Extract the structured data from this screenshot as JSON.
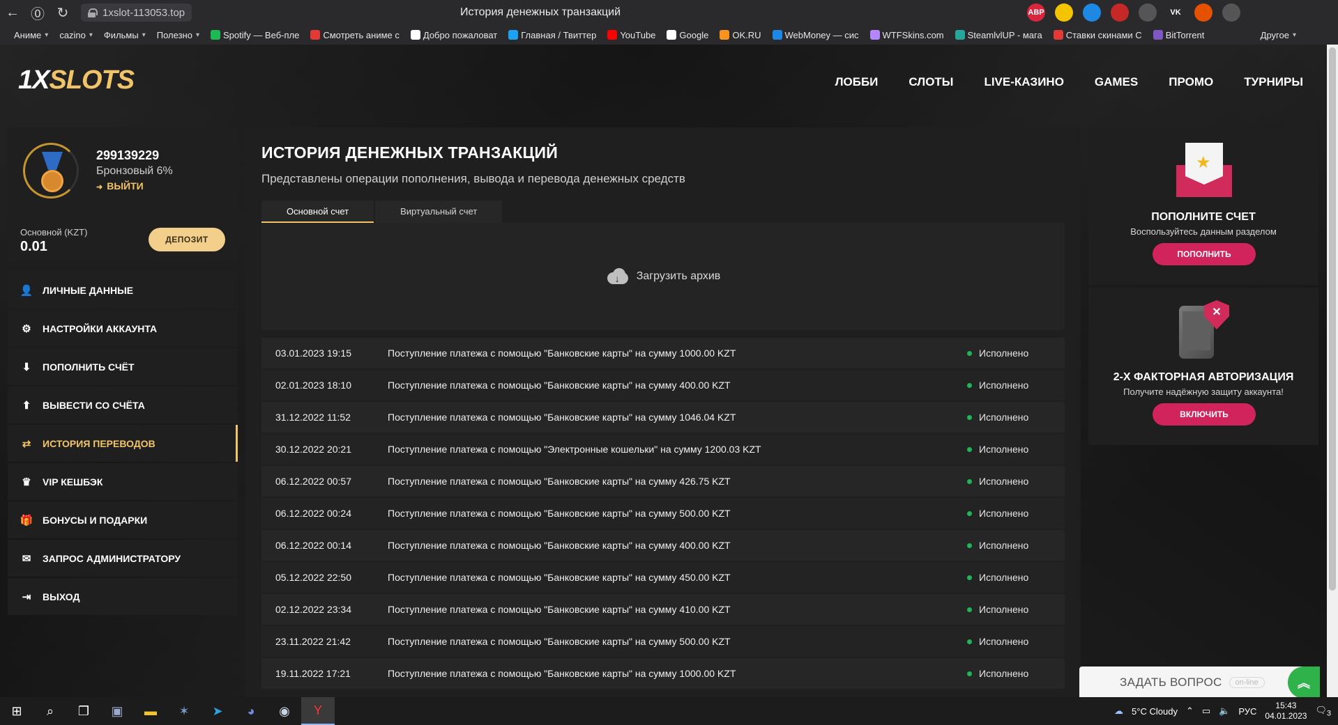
{
  "browser": {
    "url": "1xslot-113053.top",
    "tab_title": "История денежных транзакций",
    "extensions": [
      {
        "name": "adblock-icon",
        "label": "ABP",
        "color": "#d7263d"
      },
      {
        "name": "coin-icon",
        "label": "",
        "color": "#f4c400"
      },
      {
        "name": "notes-icon",
        "label": "",
        "color": "#1e88e5"
      },
      {
        "name": "shield-ext-icon",
        "label": "",
        "color": "#c62828"
      },
      {
        "name": "vpn-icon",
        "label": "",
        "color": "#555555"
      },
      {
        "name": "vk-icon",
        "label": "VK",
        "color": "#2a2a2d"
      },
      {
        "name": "arrow-ext-icon",
        "label": "",
        "color": "#e65100"
      },
      {
        "name": "gray-ext-icon",
        "label": "",
        "color": "#555555"
      },
      {
        "name": "protect-icon",
        "label": "",
        "color": "#2a2a2d"
      },
      {
        "name": "collections-icon",
        "label": "",
        "color": "#2a2a2d"
      },
      {
        "name": "download-icon",
        "label": "",
        "color": "#2a2a2d"
      }
    ]
  },
  "bookmarks": [
    {
      "label": "Аниме",
      "folder": true,
      "color": ""
    },
    {
      "label": "cazino",
      "folder": true,
      "color": ""
    },
    {
      "label": "Фильмы",
      "folder": true,
      "color": ""
    },
    {
      "label": "Полезно",
      "folder": true,
      "color": ""
    },
    {
      "label": "Spotify — Веб-пле",
      "folder": false,
      "color": "#1db954"
    },
    {
      "label": "Смотреть аниме с",
      "folder": false,
      "color": "#e53935"
    },
    {
      "label": "Добро пожаловат",
      "folder": false,
      "color": "#ffffff"
    },
    {
      "label": "Главная / Твиттер",
      "folder": false,
      "color": "#1da1f2"
    },
    {
      "label": "YouTube",
      "folder": false,
      "color": "#ff0000"
    },
    {
      "label": "Google",
      "folder": false,
      "color": "#ffffff"
    },
    {
      "label": "OK.RU",
      "folder": false,
      "color": "#f7931e"
    },
    {
      "label": "WebMoney — сис",
      "folder": false,
      "color": "#1e88e5"
    },
    {
      "label": "WTFSkins.com",
      "folder": false,
      "color": "#b388ff"
    },
    {
      "label": "SteamlvlUP - мага",
      "folder": false,
      "color": "#26a69a"
    },
    {
      "label": "Ставки скинами С",
      "folder": false,
      "color": "#e53935"
    },
    {
      "label": "BitTorrent",
      "folder": false,
      "color": "#7e57c2"
    }
  ],
  "bookmarks_other": "Другое",
  "site": {
    "logo_main": "1X",
    "logo_accent": "SLOTS",
    "nav": [
      "ЛОББИ",
      "СЛОТЫ",
      "LIVE-КАЗИНО",
      "GAMES",
      "ПРОМО",
      "ТУРНИРЫ"
    ]
  },
  "profile": {
    "user_id": "299139229",
    "level": "Бронзовый 6%",
    "logout": "ВЫЙТИ",
    "balance_label": "Основной (KZT)",
    "balance_value": "0.01",
    "deposit_button": "ДЕПОЗИТ"
  },
  "side_menu": [
    {
      "label": "ЛИЧНЫЕ ДАННЫЕ",
      "icon": "user-icon",
      "glyph": "👤",
      "active": false
    },
    {
      "label": "НАСТРОЙКИ АККАУНТА",
      "icon": "settings-icon",
      "glyph": "⚙",
      "active": false
    },
    {
      "label": "ПОПОЛНИТЬ СЧЁТ",
      "icon": "download-icon",
      "glyph": "⬇",
      "active": false
    },
    {
      "label": "ВЫВЕСТИ СО СЧЁТА",
      "icon": "upload-icon",
      "glyph": "⬆",
      "active": false
    },
    {
      "label": "ИСТОРИЯ ПЕРЕВОДОВ",
      "icon": "transfer-icon",
      "glyph": "⇄",
      "active": true
    },
    {
      "label": "VIP КЕШБЭК",
      "icon": "crown-icon",
      "glyph": "♛",
      "active": false
    },
    {
      "label": "БОНУСЫ И ПОДАРКИ",
      "icon": "gift-icon",
      "glyph": "🎁",
      "active": false
    },
    {
      "label": "ЗАПРОС АДМИНИСТРАТОРУ",
      "icon": "mail-icon",
      "glyph": "✉",
      "active": false
    },
    {
      "label": "ВЫХОД",
      "icon": "exit-icon",
      "glyph": "⇥",
      "active": false
    }
  ],
  "main": {
    "title": "ИСТОРИЯ ДЕНЕЖНЫХ ТРАНЗАКЦИЙ",
    "subtitle": "Представлены операции пополнения, вывода и перевода денежных средств",
    "tabs": [
      "Основной счет",
      "Виртуальный счет"
    ],
    "active_tab": 0,
    "archive_label": "Загрузить архив",
    "transactions": [
      {
        "date": "03.01.2023 19:15",
        "desc": "Поступление платежа с помощью \"Банковские карты\" на сумму 1000.00 KZT",
        "status": "Исполнено"
      },
      {
        "date": "02.01.2023 18:10",
        "desc": "Поступление платежа с помощью \"Банковские карты\" на сумму 400.00 KZT",
        "status": "Исполнено"
      },
      {
        "date": "31.12.2022 11:52",
        "desc": "Поступление платежа с помощью \"Банковские карты\" на сумму 1046.04 KZT",
        "status": "Исполнено"
      },
      {
        "date": "30.12.2022 20:21",
        "desc": "Поступление платежа с помощью \"Электронные кошельки\" на сумму 1200.03 KZT",
        "status": "Исполнено"
      },
      {
        "date": "06.12.2022 00:57",
        "desc": "Поступление платежа с помощью \"Банковские карты\" на сумму 426.75 KZT",
        "status": "Исполнено"
      },
      {
        "date": "06.12.2022 00:24",
        "desc": "Поступление платежа с помощью \"Банковские карты\" на сумму 500.00 KZT",
        "status": "Исполнено"
      },
      {
        "date": "06.12.2022 00:14",
        "desc": "Поступление платежа с помощью \"Банковские карты\" на сумму 400.00 KZT",
        "status": "Исполнено"
      },
      {
        "date": "05.12.2022 22:50",
        "desc": "Поступление платежа с помощью \"Банковские карты\" на сумму 450.00 KZT",
        "status": "Исполнено"
      },
      {
        "date": "02.12.2022 23:34",
        "desc": "Поступление платежа с помощью \"Банковские карты\" на сумму 410.00 KZT",
        "status": "Исполнено"
      },
      {
        "date": "23.11.2022 21:42",
        "desc": "Поступление платежа с помощью \"Банковские карты\" на сумму 500.00 KZT",
        "status": "Исполнено"
      },
      {
        "date": "19.11.2022 17:21",
        "desc": "Поступление платежа с помощью \"Банковские карты\" на сумму 1000.00 KZT",
        "status": "Исполнено"
      }
    ]
  },
  "promo": {
    "deposit_title": "ПОПОЛНИТЕ СЧЕТ",
    "deposit_text": "Воспользуйтесь данным разделом",
    "deposit_button": "ПОПОЛНИТЬ",
    "twofa_title": "2-Х ФАКТОРНАЯ АВТОРИЗАЦИЯ",
    "twofa_text": "Получите надёжную защиту аккаунта!",
    "twofa_button": "ВКЛЮЧИТЬ"
  },
  "chat": {
    "label": "ЗАДАТЬ ВОПРОС",
    "badge": "on-line"
  },
  "taskbar": {
    "weather": "5°C  Cloudy",
    "lang": "РУС",
    "time": "15:43",
    "date": "04.01.2023",
    "notifications": "3"
  },
  "colors": {
    "accent_gold": "#f1c46a",
    "accent_pink": "#d1245c",
    "status_green": "#1fb55a"
  }
}
